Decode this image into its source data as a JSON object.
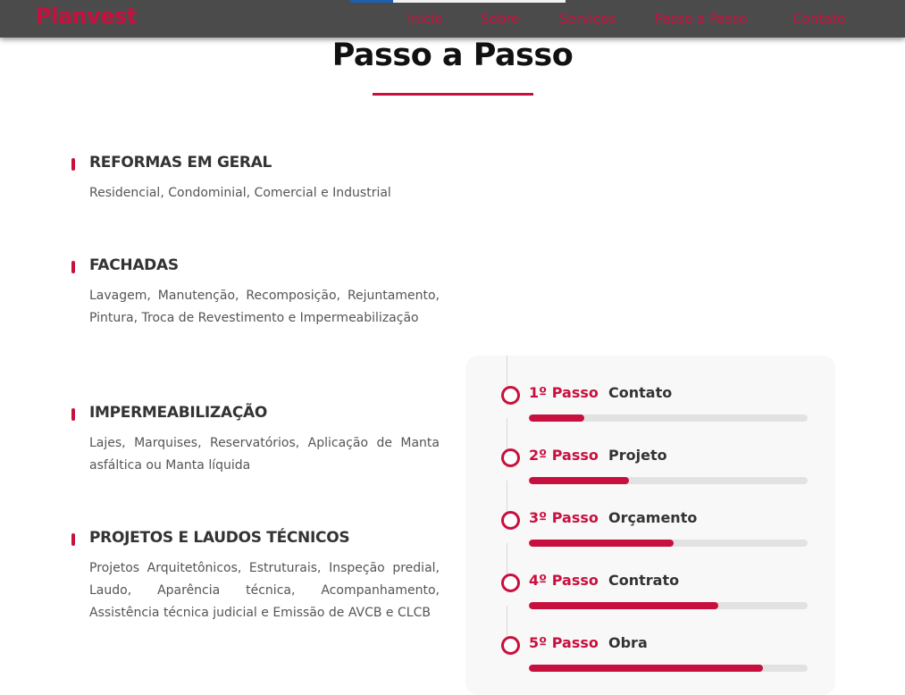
{
  "nav": {
    "logo": "Planvest",
    "links": [
      "Inicio",
      "Sobre",
      "Serviços",
      "Passo a Passo",
      "Contato"
    ]
  },
  "section": {
    "title": "Passo a Passo"
  },
  "services": [
    {
      "title": "REFORMAS EM GERAL",
      "description": "Residencial, Condominial, Comercial e Industrial"
    },
    {
      "title": "FACHADAS",
      "description": "Lavagem, Manutenção, Recomposição, Rejuntamento, Pintura, Troca de Revestimento e Impermeabilização"
    },
    {
      "title": "IMPERMEABILIZAÇÃO",
      "description": "Lajes, Marquises, Reservatórios, Aplicação de Manta asfáltica ou Manta líquida"
    },
    {
      "title": "PROJETOS E LAUDOS TÉCNICOS",
      "description": "Projetos Arquitetônicos, Estruturais, Inspeção predial, Laudo, Aparência técnica, Acompanhamento, Assistência técnica judicial e Emissão de AVCB e CLCB"
    }
  ],
  "steps": [
    {
      "number": "1º Passo",
      "label": "Contato",
      "progress": 20
    },
    {
      "number": "2º Passo",
      "label": "Projeto",
      "progress": 36
    },
    {
      "number": "3º Passo",
      "label": "Orçamento",
      "progress": 52
    },
    {
      "number": "4º Passo",
      "label": "Contrato",
      "progress": 68
    },
    {
      "number": "5º Passo",
      "label": "Obra",
      "progress": 84
    }
  ],
  "colors": {
    "accent": "#c8103e",
    "navbar": "#4b4b4b",
    "heading": "#111111",
    "text": "#555555"
  }
}
